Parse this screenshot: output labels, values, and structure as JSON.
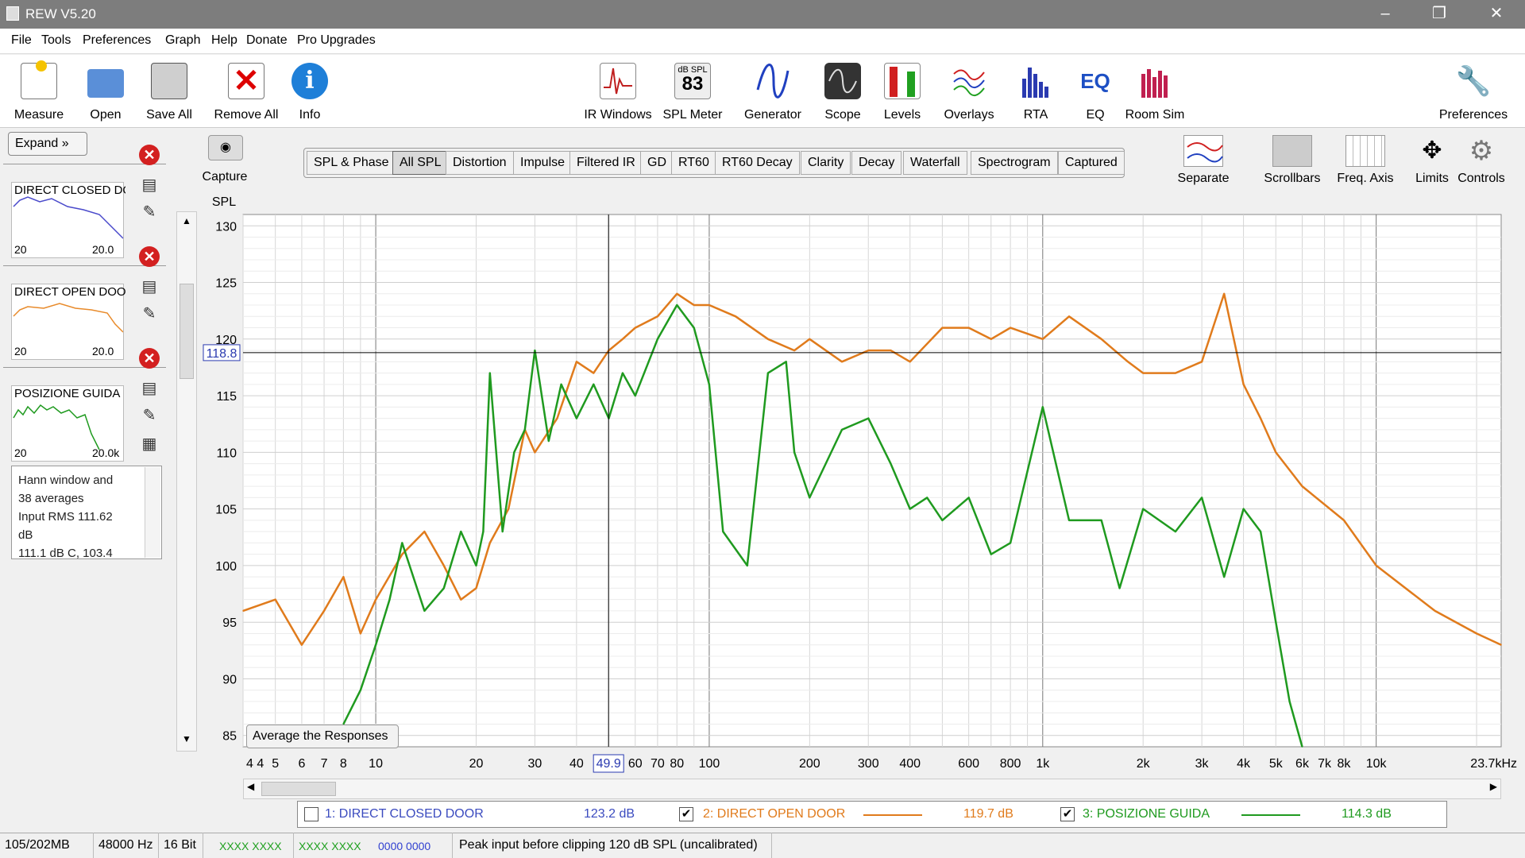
{
  "window": {
    "title": "REW V5.20"
  },
  "menu": [
    "File",
    "Tools",
    "Preferences",
    "Graph",
    "Help",
    "Donate",
    "Pro Upgrades"
  ],
  "toolbar": {
    "left": [
      {
        "label": "Measure",
        "icon": "measure-icon"
      },
      {
        "label": "Open",
        "icon": "folder-icon"
      },
      {
        "label": "Save All",
        "icon": "save-all-icon"
      },
      {
        "label": "Remove All",
        "icon": "remove-all-icon"
      },
      {
        "label": "Info",
        "icon": "info-icon"
      }
    ],
    "center": [
      {
        "label": "IR Windows",
        "icon": "ir-windows-icon"
      },
      {
        "label": "SPL Meter",
        "icon": "spl-meter-icon",
        "badge_top": "dB SPL",
        "badge_value": "83"
      },
      {
        "label": "Generator",
        "icon": "generator-icon"
      },
      {
        "label": "Scope",
        "icon": "scope-icon"
      },
      {
        "label": "Levels",
        "icon": "levels-icon"
      },
      {
        "label": "Overlays",
        "icon": "overlays-icon"
      },
      {
        "label": "RTA",
        "icon": "rta-icon"
      },
      {
        "label": "EQ",
        "icon": "eq-icon"
      },
      {
        "label": "Room Sim",
        "icon": "room-sim-icon"
      }
    ],
    "right": {
      "label": "Preferences",
      "icon": "wrench-icon"
    }
  },
  "left_panel": {
    "expand_label": "Expand",
    "measurements": [
      {
        "name": "DIRECT CLOSED DO",
        "axis_start": "20",
        "axis_end": "20.0",
        "color": "#4a4acb"
      },
      {
        "name": "DIRECT OPEN DOO",
        "axis_start": "20",
        "axis_end": "20.0",
        "color": "#e88a2a"
      },
      {
        "name": "POSIZIONE GUIDA",
        "axis_start": "20",
        "axis_end": "20.0k",
        "color": "#1f9a1f"
      }
    ],
    "info_lines": [
      "Hann window and",
      "38 averages",
      "Input RMS 111.62",
      "dB",
      "111.1 dB C, 103.4"
    ]
  },
  "capture": {
    "label": "Capture"
  },
  "graph_tabs": [
    "SPL & Phase",
    "All SPL",
    "Distortion",
    "Impulse",
    "Filtered IR",
    "GD",
    "RT60",
    "RT60 Decay",
    "Clarity",
    "Decay",
    "Waterfall",
    "Spectrogram",
    "Captured"
  ],
  "graph_tab_selected": "All SPL",
  "graph_tools": [
    {
      "label": "Separate",
      "icon": "separate-icon"
    },
    {
      "label": "Scrollbars",
      "icon": "scrollbars-icon"
    },
    {
      "label": "Freq. Axis",
      "icon": "freq-axis-icon"
    },
    {
      "label": "Limits",
      "icon": "limits-icon"
    },
    {
      "label": "Controls",
      "icon": "controls-gear-icon"
    }
  ],
  "average_button": "Average the Responses",
  "cursor": {
    "y_value": "118.8",
    "x_value": "49.9"
  },
  "chart_data": {
    "type": "line",
    "ylabel": "SPL",
    "xunit": "Hz",
    "x_scale": "log",
    "xlim": [
      4,
      23700
    ],
    "ylim": [
      84,
      131
    ],
    "yticks": [
      85,
      90,
      95,
      100,
      105,
      110,
      115,
      120,
      125,
      130
    ],
    "ytick_labels": [
      "85",
      "90",
      "95",
      "100",
      "105",
      "110",
      "115",
      "120",
      "125",
      "130"
    ],
    "xticks": [
      4,
      5,
      6,
      7,
      8,
      10,
      20,
      30,
      40,
      60,
      70,
      80,
      100,
      200,
      300,
      400,
      600,
      800,
      1000,
      2000,
      3000,
      4000,
      5000,
      6000,
      7000,
      8000,
      10000,
      23700
    ],
    "xtick_labels": [
      "4 4",
      "5",
      "6",
      "7",
      "8",
      "10",
      "20",
      "30",
      "40",
      "60",
      "70",
      "80",
      "100",
      "200",
      "300",
      "400",
      "600",
      "800",
      "1k",
      "2k",
      "3k",
      "4k",
      "5k",
      "6k",
      "7k",
      "8k",
      "10k",
      "23.7kHz"
    ],
    "grid": true,
    "series": [
      {
        "name": "DIRECT OPEN DOOR",
        "color": "#e07b1c",
        "x": [
          4,
          5,
          6,
          7,
          8,
          9,
          10,
          12,
          14,
          16,
          18,
          20,
          22,
          25,
          28,
          30,
          35,
          40,
          45,
          50,
          55,
          60,
          70,
          80,
          90,
          100,
          120,
          150,
          180,
          200,
          250,
          300,
          350,
          400,
          500,
          600,
          700,
          800,
          1000,
          1200,
          1500,
          1800,
          2000,
          2500,
          3000,
          3500,
          4000,
          4500,
          5000,
          6000,
          8000,
          10000,
          15000,
          20000,
          23700
        ],
        "y": [
          96,
          97,
          93,
          96,
          99,
          94,
          97,
          101,
          103,
          100,
          97,
          98,
          102,
          105,
          112,
          110,
          113,
          118,
          117,
          119,
          120,
          121,
          122,
          124,
          123,
          123,
          122,
          120,
          119,
          120,
          118,
          119,
          119,
          118,
          121,
          121,
          120,
          121,
          120,
          122,
          120,
          118,
          117,
          117,
          118,
          124,
          116,
          113,
          110,
          107,
          104,
          100,
          96,
          94,
          93
        ]
      },
      {
        "name": "POSIZIONE GUIDA",
        "color": "#1f9a1f",
        "x": [
          8,
          9,
          10,
          11,
          12,
          14,
          16,
          18,
          20,
          21,
          22,
          24,
          26,
          28,
          30,
          33,
          36,
          40,
          45,
          50,
          55,
          60,
          70,
          80,
          90,
          100,
          110,
          130,
          150,
          170,
          180,
          200,
          250,
          300,
          350,
          400,
          450,
          500,
          600,
          700,
          800,
          1000,
          1200,
          1500,
          1700,
          2000,
          2500,
          3000,
          3500,
          4000,
          4500,
          5000,
          5500,
          6000
        ],
        "y": [
          86,
          89,
          93,
          97,
          102,
          96,
          98,
          103,
          100,
          103,
          117,
          103,
          110,
          112,
          119,
          111,
          116,
          113,
          116,
          113,
          117,
          115,
          120,
          123,
          121,
          116,
          103,
          100,
          117,
          118,
          110,
          106,
          112,
          113,
          109,
          105,
          106,
          104,
          106,
          101,
          102,
          114,
          104,
          104,
          98,
          105,
          103,
          106,
          99,
          105,
          103,
          95,
          88,
          84
        ]
      }
    ]
  },
  "legend": [
    {
      "label": "1: DIRECT CLOSED DOOR",
      "value": "123.2 dB",
      "checked": false,
      "color": "#3b4bbf"
    },
    {
      "label": "2: DIRECT OPEN DOOR",
      "value": "119.7 dB",
      "checked": true,
      "color": "#e07b1c"
    },
    {
      "label": "3: POSIZIONE GUIDA",
      "value": "114.3 dB",
      "checked": true,
      "color": "#1f9a1f"
    }
  ],
  "status": {
    "memory": "105/202MB",
    "rate": "48000 Hz",
    "bits": "16 Bit",
    "meter_a": "XXXX XXXX",
    "meter_b": "XXXX XXXX",
    "meter_c": "0000 0000",
    "message": "Peak input before clipping 120 dB SPL (uncalibrated)"
  }
}
